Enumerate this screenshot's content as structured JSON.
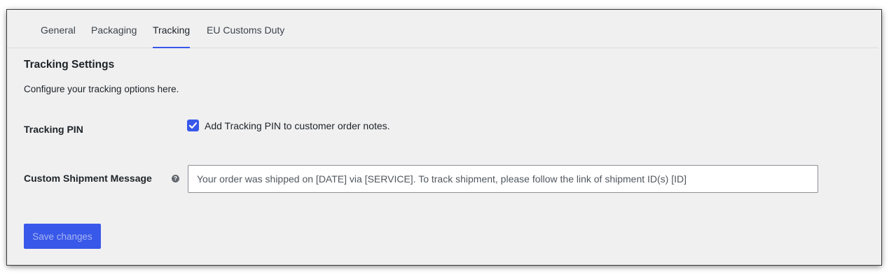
{
  "tabs": [
    {
      "label": "General",
      "active": false
    },
    {
      "label": "Packaging",
      "active": false
    },
    {
      "label": "Tracking",
      "active": true
    },
    {
      "label": "EU Customs Duty",
      "active": false
    }
  ],
  "section": {
    "title": "Tracking Settings",
    "description": "Configure your tracking options here."
  },
  "tracking_pin": {
    "label": "Tracking PIN",
    "checkbox_label": "Add Tracking PIN to customer order notes.",
    "checked": true
  },
  "custom_message": {
    "label": "Custom Shipment Message",
    "help_icon": "question-mark-icon",
    "placeholder": "Your order was shipped on [DATE] via [SERVICE]. To track shipment, please follow the link of shipment ID(s) [ID]",
    "value": ""
  },
  "actions": {
    "save_label": "Save changes"
  },
  "colors": {
    "accent": "#3858e9",
    "background": "#f0f0f1",
    "text": "#1d2327"
  }
}
